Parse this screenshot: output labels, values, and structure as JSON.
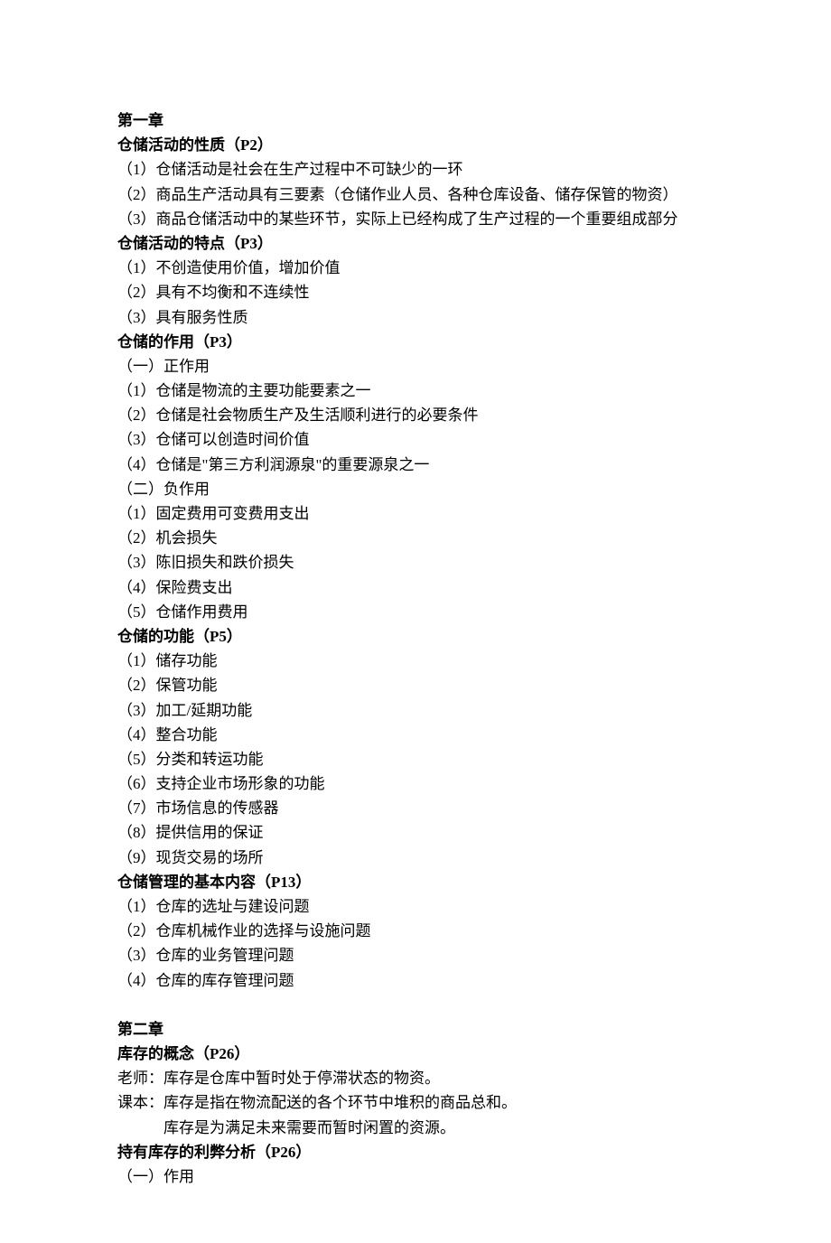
{
  "chapter1": {
    "title": "第一章",
    "section1": {
      "heading": "仓储活动的性质（P2）",
      "items": [
        "（1）仓储活动是社会在生产过程中不可缺少的一环",
        "（2）商品生产活动具有三要素（仓储作业人员、各种仓库设备、储存保管的物资）",
        "（3）商品仓储活动中的某些环节，实际上已经构成了生产过程的一个重要组成部分"
      ]
    },
    "section2": {
      "heading": "仓储活动的特点（P3）",
      "items": [
        "（1）不创造使用价值，增加价值",
        "（2）具有不均衡和不连续性",
        "（3）具有服务性质"
      ]
    },
    "section3": {
      "heading": "仓储的作用（P3）",
      "sub1_heading": "（一）正作用",
      "sub1_items": [
        "（1）仓储是物流的主要功能要素之一",
        "（2）仓储是社会物质生产及生活顺利进行的必要条件",
        "（3）仓储可以创造时间价值",
        "（4）仓储是\"第三方利润源泉\"的重要源泉之一"
      ],
      "sub2_heading": "（二）负作用",
      "sub2_items": [
        "（1）固定费用可变费用支出",
        "（2）机会损失",
        "（3）陈旧损失和跌价损失",
        "（4）保险费支出",
        "（5）仓储作用费用"
      ]
    },
    "section4": {
      "heading": "仓储的功能（P5）",
      "items": [
        "（1）储存功能",
        "（2）保管功能",
        "（3）加工/延期功能",
        "（4）整合功能",
        "（5）分类和转运功能",
        "（6）支持企业市场形象的功能",
        "（7）市场信息的传感器",
        "（8）提供信用的保证",
        "（9）现货交易的场所"
      ]
    },
    "section5": {
      "heading": "仓储管理的基本内容（P13）",
      "items": [
        "（1）仓库的选址与建设问题",
        "（2）仓库机械作业的选择与设施问题",
        "（3）仓库的业务管理问题",
        "（4）仓库的库存管理问题"
      ]
    }
  },
  "chapter2": {
    "title": "第二章",
    "section1": {
      "heading": "库存的概念（P26）",
      "items": [
        "老师：库存是仓库中暂时处于停滞状态的物资。",
        "课本：库存是指在物流配送的各个环节中堆积的商品总和。",
        "            库存是为满足未来需要而暂时闲置的资源。"
      ]
    },
    "section2": {
      "heading": "持有库存的利弊分析（P26）",
      "sub1_heading": "（一）作用"
    }
  }
}
